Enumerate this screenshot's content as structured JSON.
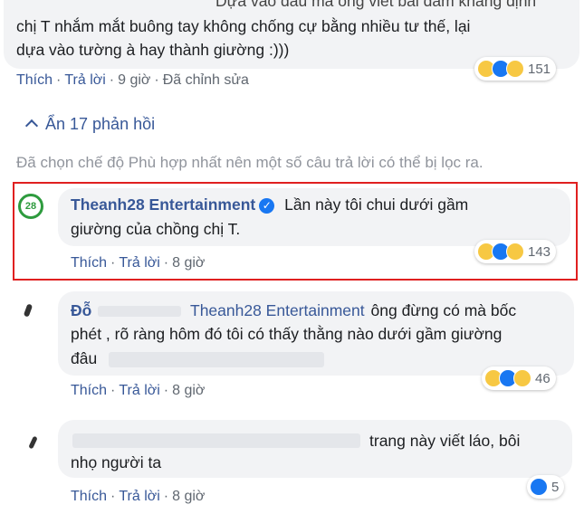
{
  "comment_top": {
    "line1": "Dựa vào đâu mà ông viết bài dám khẳng định",
    "line2": "chị T nhắm mắt buông tay không chống cự bằng nhiều tư thế, lại",
    "line3": "dựa vào tường à hay thành giường :)))",
    "reaction_count": "151",
    "actions": {
      "like": "Thích",
      "reply": "Trả lời",
      "time": "9 giờ",
      "edited": "Đã chỉnh sửa"
    }
  },
  "hide_replies": {
    "arrow": "^",
    "label": "Ẩn 17 phản hồi"
  },
  "filter_notice": "Đã chọn chế độ Phù hợp nhất nên một số câu trả lời có thể bị lọc ra.",
  "reply_1": {
    "author": "Theanh28 Entertainment",
    "avatar_text": "28",
    "verified_mark": "✓",
    "line1": "Lần này tôi chui dưới gầm",
    "line2": "giường của chồng chị T.",
    "reaction_count": "143",
    "actions": {
      "like": "Thích",
      "reply": "Trả lời",
      "time": "8 giờ"
    }
  },
  "reply_2": {
    "author_partial": "Đỗ",
    "tag": "Theanh28 Entertainment",
    "line1_rest": "ông đừng có mà bốc",
    "line2": "phét , rõ ràng hôm đó tôi có thấy thằng nào dưới gầm giường",
    "line3": "đâu",
    "reaction_count": "46",
    "actions": {
      "like": "Thích",
      "reply": "Trả lời",
      "time": "8 giờ"
    }
  },
  "reply_3": {
    "line1": "trang này viết láo, bôi",
    "line2": "nhọ người ta",
    "reaction_count": "5",
    "actions": {
      "like": "Thích",
      "reply": "Trả lời",
      "time": "8 giờ"
    }
  },
  "colors": {
    "link": "#385898",
    "highlight": "#e02020",
    "bubble": "#f2f3f5"
  }
}
